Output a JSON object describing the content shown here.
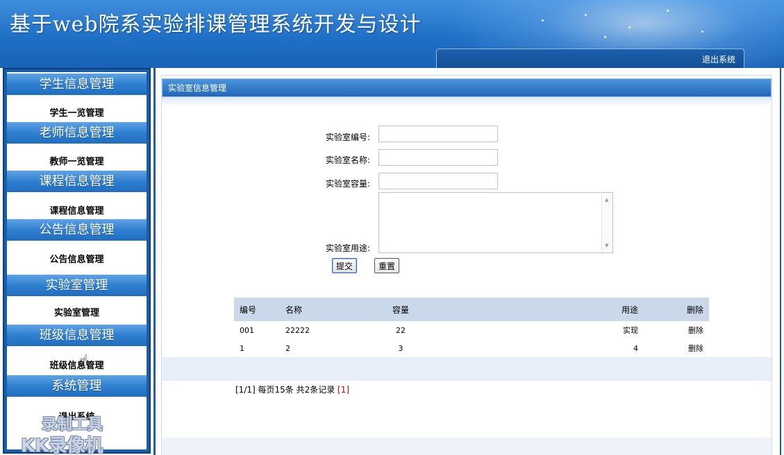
{
  "header": {
    "title": "基于web院系实验排课管理系统开发与设计",
    "logout": "退出系统"
  },
  "sidebar": {
    "sections": [
      {
        "title": "学生信息管理",
        "item": "学生一览管理"
      },
      {
        "title": "老师信息管理",
        "item": "教师一览管理"
      },
      {
        "title": "课程信息管理",
        "item": "课程信息管理"
      },
      {
        "title": "公告信息管理",
        "item": "公告信息管理"
      },
      {
        "title": "实验室管理",
        "item": "实验室管理"
      },
      {
        "title": "班级信息管理",
        "item": "班级信息管理"
      },
      {
        "title": "系统管理",
        "item": "退出系统"
      }
    ]
  },
  "watermark": {
    "line1": "录制工具",
    "line2": "KK录像机"
  },
  "panel": {
    "title": "实验室信息管理"
  },
  "form": {
    "id_label": "实验室编号:",
    "name_label": "实验室名称:",
    "capacity_label": "实验室容量:",
    "usage_label": "实验室用途:",
    "id_value": "",
    "name_value": "",
    "capacity_value": "",
    "usage_value": "",
    "submit": "提交",
    "reset": "重置"
  },
  "table": {
    "headers": [
      "编号",
      "名称",
      "容量",
      "用途",
      "删除"
    ],
    "rows": [
      [
        "001",
        "22222",
        "22",
        "实现",
        "删除"
      ],
      [
        "1",
        "2",
        "3",
        "4",
        "删除"
      ]
    ]
  },
  "pager": {
    "info": "[1/1] 每页15条 共2条记录",
    "page": "[1]"
  },
  "colors": {
    "header_blue": "#1f6fc7",
    "menu_blue": "#2f7fd0",
    "table_header": "#c9d9ea",
    "pager_link": "#cc0000"
  }
}
